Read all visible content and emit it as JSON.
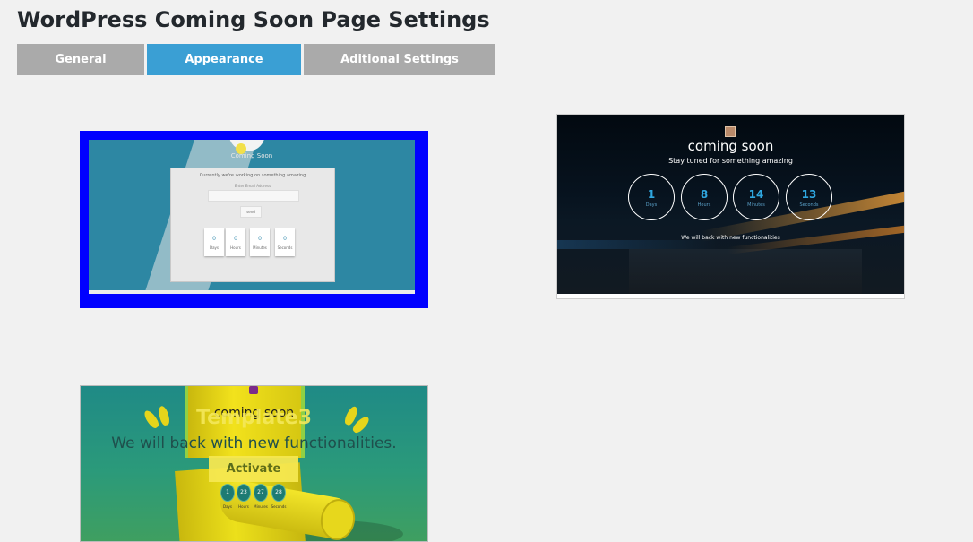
{
  "page": {
    "title": "WordPress Coming Soon Page Settings"
  },
  "tabs": [
    {
      "label": "General",
      "active": false
    },
    {
      "label": "Appearance",
      "active": true
    },
    {
      "label": "Aditional Settings",
      "active": false
    }
  ],
  "colors": {
    "tab_active": "#3a9fd4",
    "tab_inactive": "#aaaaaa",
    "selected_border": "#0000ff"
  },
  "templates": [
    {
      "selected": true,
      "preview": {
        "logo_text": "Coming Soon",
        "line1": "Currently we're working on something amazing",
        "field_label": "Enter Email Address",
        "button": "send",
        "countdown": [
          {
            "value": "0",
            "unit": "Days"
          },
          {
            "value": "0",
            "unit": "Hours"
          },
          {
            "value": "0",
            "unit": "Minutes"
          },
          {
            "value": "0",
            "unit": "Seconds"
          }
        ]
      }
    },
    {
      "selected": false,
      "preview": {
        "title": "coming soon",
        "subtitle": "Stay tuned for something amazing",
        "countdown": [
          {
            "value": "1",
            "unit": "Days"
          },
          {
            "value": "8",
            "unit": "Hours"
          },
          {
            "value": "14",
            "unit": "Minutes"
          },
          {
            "value": "13",
            "unit": "Seconds"
          }
        ],
        "message": "We will back with new functionalities"
      }
    },
    {
      "selected": false,
      "label": "Template3",
      "activate_label": "Activate",
      "preview": {
        "title": "coming soon",
        "message": "We will back with new functionalities.",
        "countdown": [
          {
            "value": "1",
            "unit": "Days"
          },
          {
            "value": "23",
            "unit": "Hours"
          },
          {
            "value": "27",
            "unit": "Minutes"
          },
          {
            "value": "28",
            "unit": "Seconds"
          }
        ]
      }
    }
  ]
}
